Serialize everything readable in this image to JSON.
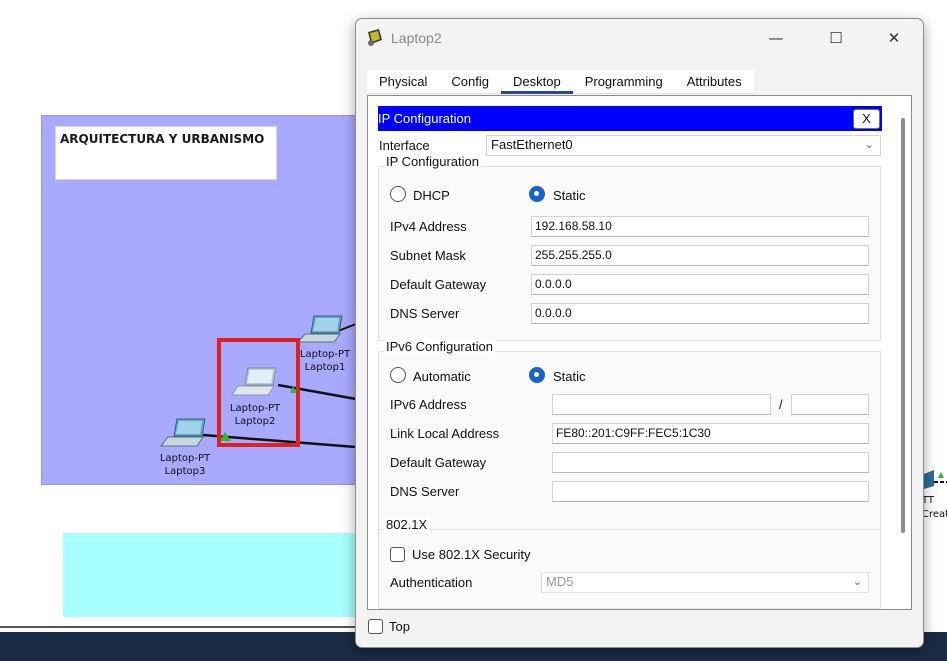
{
  "workspace": {
    "note_title": "ARQUITECTURA Y URBANISMO",
    "devices": [
      {
        "type": "Laptop-PT",
        "name": "Laptop1"
      },
      {
        "type": "Laptop-PT",
        "name": "Laptop2"
      },
      {
        "type": "Laptop-PT",
        "name": "Laptop3"
      }
    ],
    "right_label_line1": "TT",
    "right_label_line2": "Creat"
  },
  "window": {
    "title": "Laptop2",
    "minimize": "—",
    "maximize": "☐",
    "close": "✕"
  },
  "tabs": [
    "Physical",
    "Config",
    "Desktop",
    "Programming",
    "Attributes"
  ],
  "active_tab": "Desktop",
  "ip_config": {
    "header": "IP Configuration",
    "close_label": "X",
    "interface_label": "Interface",
    "interface_value": "FastEthernet0",
    "ipv4": {
      "group_title": "IP Configuration",
      "dhcp_label": "DHCP",
      "static_label": "Static",
      "mode": "Static",
      "fields": [
        {
          "label": "IPv4 Address",
          "value": "192.168.58.10"
        },
        {
          "label": "Subnet Mask",
          "value": "255.255.255.0"
        },
        {
          "label": "Default Gateway",
          "value": "0.0.0.0"
        },
        {
          "label": "DNS Server",
          "value": "0.0.0.0"
        }
      ]
    },
    "ipv6": {
      "group_title": "IPv6 Configuration",
      "automatic_label": "Automatic",
      "static_label": "Static",
      "mode": "Static",
      "address_label": "IPv6 Address",
      "address_value": "",
      "prefix_separator": "/",
      "prefix_value": "",
      "link_local_label": "Link Local Address",
      "link_local_value": "FE80::201:C9FF:FEC5:1C30",
      "gateway_label": "Default Gateway",
      "gateway_value": "",
      "dns_label": "DNS Server",
      "dns_value": ""
    },
    "dot1x": {
      "group_title": "802.1X",
      "use_label": "Use 802.1X Security",
      "use_checked": false,
      "auth_label": "Authentication",
      "auth_value": "MD5"
    }
  },
  "footer": {
    "top_label": "Top",
    "top_checked": false
  },
  "colors": {
    "cluster": "#a9a9ff",
    "header_blue": "#0000ff",
    "selection": "#e02121",
    "radio_selected": "#1763c9"
  }
}
